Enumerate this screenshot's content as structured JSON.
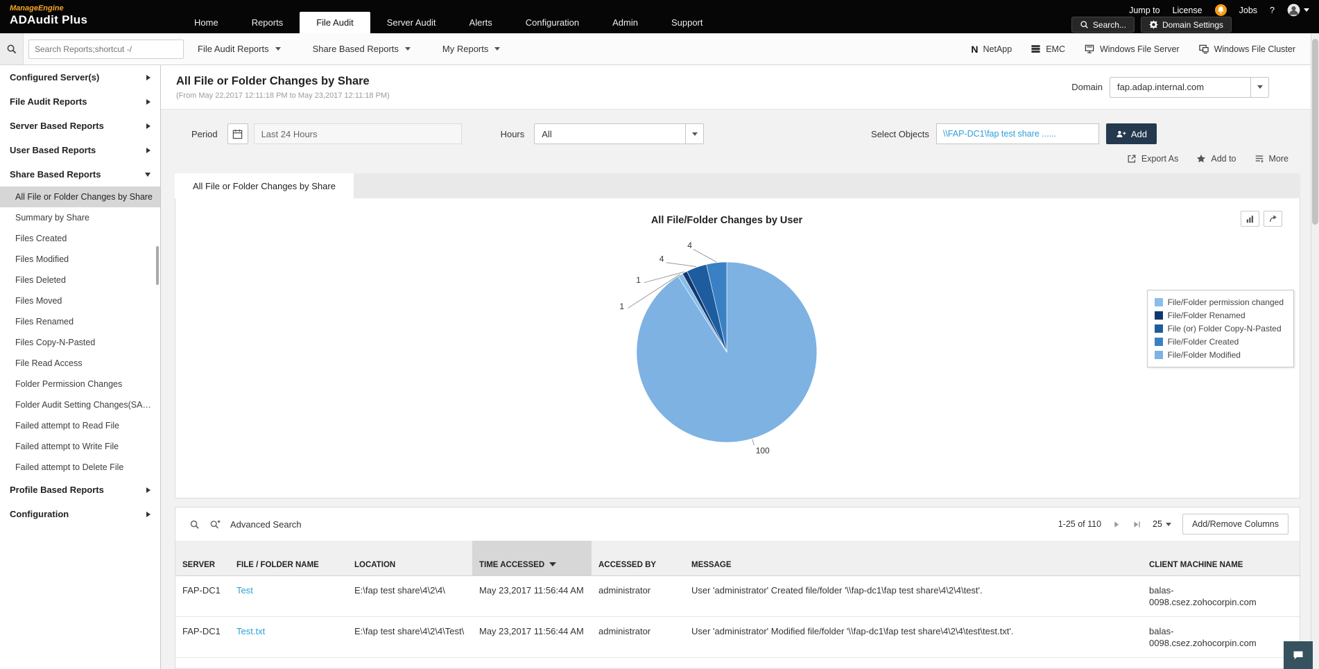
{
  "topbar": {
    "brand": "ManageEngine",
    "product": "ADAudit Plus",
    "nav": [
      "Home",
      "Reports",
      "File Audit",
      "Server Audit",
      "Alerts",
      "Configuration",
      "Admin",
      "Support"
    ],
    "active_nav": "File Audit",
    "links_left": [
      "Jump to",
      "License"
    ],
    "links_right": [
      "Jobs",
      "?"
    ],
    "search_button": "Search...",
    "domain_settings_button": "Domain Settings"
  },
  "toolbar": {
    "search_placeholder": "Search Reports;shortcut -/",
    "menus": [
      "File Audit Reports",
      "Share Based Reports",
      "My Reports"
    ],
    "server_types": [
      {
        "label": "NetApp",
        "icon": "netapp-icon"
      },
      {
        "label": "EMC",
        "icon": "emc-icon"
      },
      {
        "label": "Windows File Server",
        "icon": "windows-file-server-icon"
      },
      {
        "label": "Windows File Cluster",
        "icon": "windows-file-cluster-icon"
      }
    ]
  },
  "sidebar": {
    "groups": [
      {
        "label": "Configured Server(s)",
        "expanded": false
      },
      {
        "label": "File Audit Reports",
        "expanded": false
      },
      {
        "label": "Server Based Reports",
        "expanded": false
      },
      {
        "label": "User Based Reports",
        "expanded": false
      },
      {
        "label": "Share Based Reports",
        "expanded": true,
        "items": [
          "All File or Folder Changes by Share",
          "Summary by Share",
          "Files Created",
          "Files Modified",
          "Files Deleted",
          "Files Moved",
          "Files Renamed",
          "Files Copy-N-Pasted",
          "File Read Access",
          "Folder Permission Changes",
          "Folder Audit Setting Changes(SACL)",
          "Failed attempt to Read File",
          "Failed attempt to Write File",
          "Failed attempt to Delete File"
        ]
      },
      {
        "label": "Profile Based Reports",
        "expanded": false
      },
      {
        "label": "Configuration",
        "expanded": false
      }
    ],
    "selected_item": "All File or Folder Changes by Share"
  },
  "report": {
    "title": "All File or Folder Changes by Share",
    "subtitle": "(From May 22,2017 12:11:18 PM to May 23,2017 12:11:18 PM)",
    "domain_label": "Domain",
    "domain_value": "fap.adap.internal.com",
    "period_label": "Period",
    "period_value": "Last 24 Hours",
    "hours_label": "Hours",
    "hours_value": "All",
    "select_objects_label": "Select Objects",
    "select_objects_value": "\\\\FAP-DC1\\fap test share ......",
    "add_button_label": "Add",
    "export_as_label": "Export As",
    "add_to_label": "Add to",
    "more_label": "More",
    "tab_label": "All File or Folder Changes by Share"
  },
  "chart_data": {
    "type": "pie",
    "title": "All File/Folder Changes by User",
    "legend_position": "right",
    "total": 110,
    "slices": [
      {
        "label": "File/Folder permission changed",
        "value": 1,
        "color": "#8bbde8"
      },
      {
        "label": "File/Folder Renamed",
        "value": 1,
        "color": "#10386e"
      },
      {
        "label": "File (or) Folder Copy-N-Pasted",
        "value": 4,
        "color": "#1d5c9e"
      },
      {
        "label": "File/Folder Created",
        "value": 4,
        "color": "#3a80c4"
      },
      {
        "label": "File/Folder Modified",
        "value": 100,
        "color": "#7db2e2"
      }
    ]
  },
  "table": {
    "advanced_search_label": "Advanced Search",
    "range_text": "1-25 of 110",
    "page_size": "25",
    "add_remove_columns_label": "Add/Remove Columns",
    "sorted_column": "TIME ACCESSED",
    "columns": [
      {
        "label": "SERVER",
        "key": "server"
      },
      {
        "label": "FILE / FOLDER NAME",
        "key": "file",
        "link": true
      },
      {
        "label": "LOCATION",
        "key": "location"
      },
      {
        "label": "TIME ACCESSED",
        "key": "time",
        "sorted": "desc"
      },
      {
        "label": "ACCESSED BY",
        "key": "by"
      },
      {
        "label": "MESSAGE",
        "key": "message"
      },
      {
        "label": "CLIENT MACHINE NAME",
        "key": "client"
      }
    ],
    "rows": [
      {
        "server": "FAP-DC1",
        "file": "Test",
        "location": "E:\\fap test share\\4\\2\\4\\",
        "time": "May 23,2017 11:56:44 AM",
        "by": "administrator",
        "message": "User 'administrator' Created file/folder '\\\\fap-dc1\\fap test share\\4\\2\\4\\test'.",
        "client": "balas-0098.csez.zohocorpin.com"
      },
      {
        "server": "FAP-DC1",
        "file": "Test.txt",
        "location": "E:\\fap test share\\4\\2\\4\\Test\\",
        "time": "May 23,2017 11:56:44 AM",
        "by": "administrator",
        "message": "User 'administrator' Modified file/folder '\\\\fap-dc1\\fap test share\\4\\2\\4\\test\\test.txt'.",
        "client": "balas-0098.csez.zohocorpin.com"
      }
    ]
  }
}
